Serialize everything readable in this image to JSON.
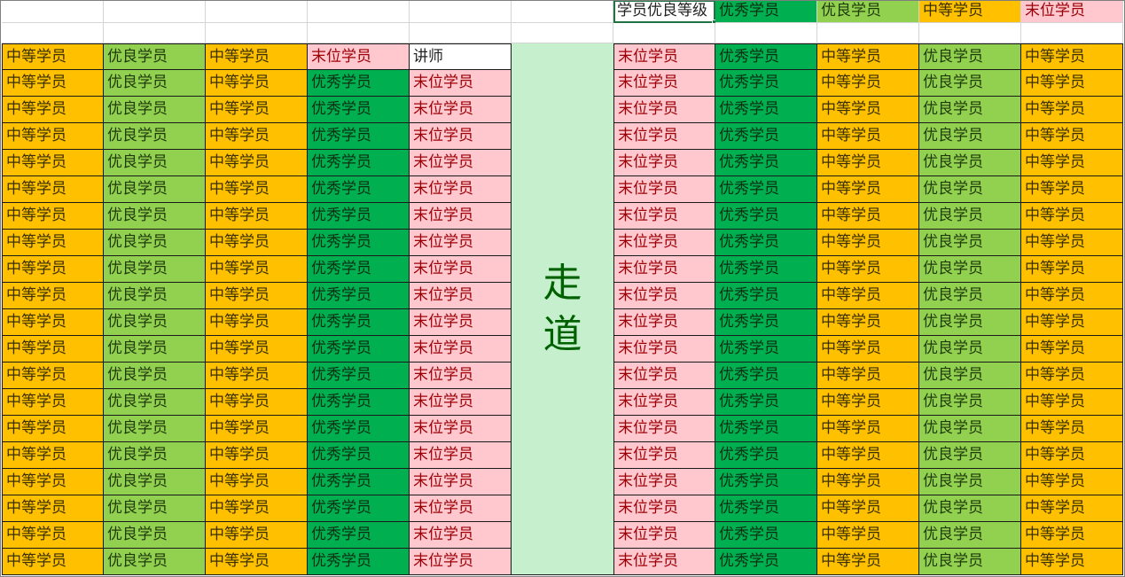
{
  "legend": {
    "header": "学员优良等级",
    "items": [
      {
        "label": "优秀学员",
        "color": "#00b050"
      },
      {
        "label": "优良学员",
        "color": "#92d050"
      },
      {
        "label": "中等学员",
        "color": "#ffc000"
      },
      {
        "label": "末位学员",
        "color": "#ffc7ce"
      }
    ]
  },
  "aisle": {
    "chars": [
      "走",
      "道"
    ],
    "color": "#c6efce"
  },
  "labels": {
    "excellent": "优秀学员",
    "good": "优良学员",
    "average": "中等学员",
    "last": "末位学员",
    "teacher": "讲师"
  },
  "seating": {
    "left_rows": [
      [
        "average",
        "good",
        "average",
        "last",
        "teacher"
      ],
      [
        "average",
        "good",
        "average",
        "excellent",
        "last"
      ],
      [
        "average",
        "good",
        "average",
        "excellent",
        "last"
      ],
      [
        "average",
        "good",
        "average",
        "excellent",
        "last"
      ],
      [
        "average",
        "good",
        "average",
        "excellent",
        "last"
      ],
      [
        "average",
        "good",
        "average",
        "excellent",
        "last"
      ],
      [
        "average",
        "good",
        "average",
        "excellent",
        "last"
      ],
      [
        "average",
        "good",
        "average",
        "excellent",
        "last"
      ],
      [
        "average",
        "good",
        "average",
        "excellent",
        "last"
      ],
      [
        "average",
        "good",
        "average",
        "excellent",
        "last"
      ],
      [
        "average",
        "good",
        "average",
        "excellent",
        "last"
      ],
      [
        "average",
        "good",
        "average",
        "excellent",
        "last"
      ],
      [
        "average",
        "good",
        "average",
        "excellent",
        "last"
      ],
      [
        "average",
        "good",
        "average",
        "excellent",
        "last"
      ],
      [
        "average",
        "good",
        "average",
        "excellent",
        "last"
      ],
      [
        "average",
        "good",
        "average",
        "excellent",
        "last"
      ],
      [
        "average",
        "good",
        "average",
        "excellent",
        "last"
      ],
      [
        "average",
        "good",
        "average",
        "excellent",
        "last"
      ],
      [
        "average",
        "good",
        "average",
        "excellent",
        "last"
      ],
      [
        "average",
        "good",
        "average",
        "excellent",
        "last"
      ]
    ],
    "right_rows": [
      [
        "last",
        "excellent",
        "average",
        "good",
        "average"
      ],
      [
        "last",
        "excellent",
        "average",
        "good",
        "average"
      ],
      [
        "last",
        "excellent",
        "average",
        "good",
        "average"
      ],
      [
        "last",
        "excellent",
        "average",
        "good",
        "average"
      ],
      [
        "last",
        "excellent",
        "average",
        "good",
        "average"
      ],
      [
        "last",
        "excellent",
        "average",
        "good",
        "average"
      ],
      [
        "last",
        "excellent",
        "average",
        "good",
        "average"
      ],
      [
        "last",
        "excellent",
        "average",
        "good",
        "average"
      ],
      [
        "last",
        "excellent",
        "average",
        "good",
        "average"
      ],
      [
        "last",
        "excellent",
        "average",
        "good",
        "average"
      ],
      [
        "last",
        "excellent",
        "average",
        "good",
        "average"
      ],
      [
        "last",
        "excellent",
        "average",
        "good",
        "average"
      ],
      [
        "last",
        "excellent",
        "average",
        "good",
        "average"
      ],
      [
        "last",
        "excellent",
        "average",
        "good",
        "average"
      ],
      [
        "last",
        "excellent",
        "average",
        "good",
        "average"
      ],
      [
        "last",
        "excellent",
        "average",
        "good",
        "average"
      ],
      [
        "last",
        "excellent",
        "average",
        "good",
        "average"
      ],
      [
        "last",
        "excellent",
        "average",
        "good",
        "average"
      ],
      [
        "last",
        "excellent",
        "average",
        "good",
        "average"
      ],
      [
        "last",
        "excellent",
        "average",
        "good",
        "average"
      ]
    ]
  }
}
